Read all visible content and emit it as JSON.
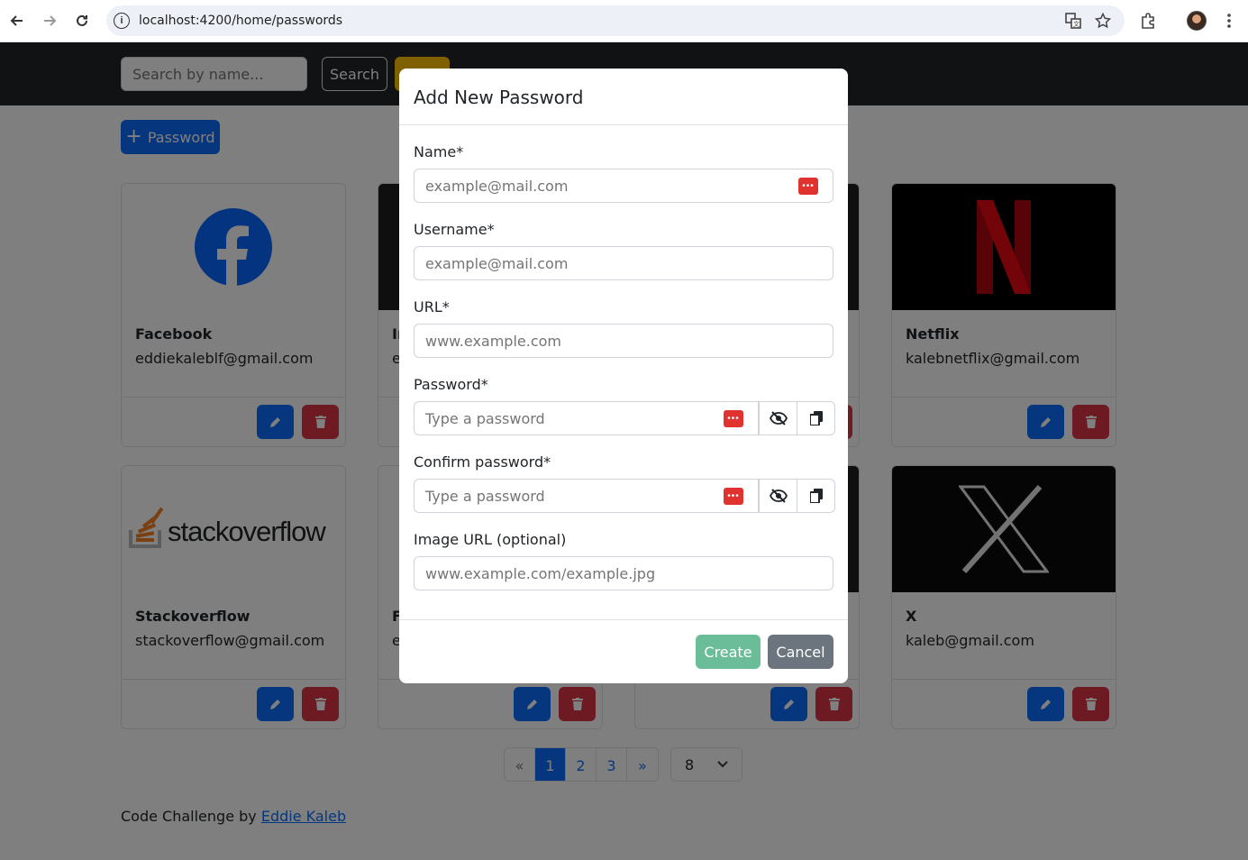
{
  "browser": {
    "url": "localhost:4200/home/passwords"
  },
  "header": {
    "search_placeholder": "Search by name...",
    "search_label": "Search"
  },
  "toolbar": {
    "add_label": "Password"
  },
  "cards": [
    {
      "name": "Facebook",
      "email": "eddiekaleblf@gmail.com"
    },
    {
      "name": "In",
      "email": "e"
    },
    {
      "name": "",
      "email": ""
    },
    {
      "name": "Netflix",
      "email": "kalebnetflix@gmail.com"
    },
    {
      "name": "Stackoverflow",
      "email": "stackoverflow@gmail.com",
      "logo_text": "stackoverflow"
    },
    {
      "name": "F",
      "email": "e"
    },
    {
      "name": "",
      "email": ""
    },
    {
      "name": "X",
      "email": "kaleb@gmail.com"
    }
  ],
  "pagination": {
    "prev": "«",
    "pages": [
      "1",
      "2",
      "3"
    ],
    "next": "»",
    "current": 1,
    "per_page": "8"
  },
  "footer": {
    "text": "Code Challenge by",
    "link": "Eddie Kaleb"
  },
  "modal": {
    "title": "Add New Password",
    "fields": {
      "name": {
        "label": "Name*",
        "placeholder": "example@mail.com"
      },
      "username": {
        "label": "Username*",
        "placeholder": "example@mail.com"
      },
      "url": {
        "label": "URL*",
        "placeholder": "www.example.com"
      },
      "password": {
        "label": "Password*",
        "placeholder": "Type a password"
      },
      "confirm": {
        "label": "Confirm password*",
        "placeholder": "Type a password"
      },
      "image": {
        "label": "Image URL (optional)",
        "placeholder": "www.example.com/example.jpg"
      }
    },
    "create_label": "Create",
    "cancel_label": "Cancel"
  },
  "colors": {
    "primary": "#0d6efd",
    "danger": "#dc3545",
    "warning": "#ffc107",
    "success_faded": "#6bbd9a",
    "secondary": "#6c757d"
  }
}
